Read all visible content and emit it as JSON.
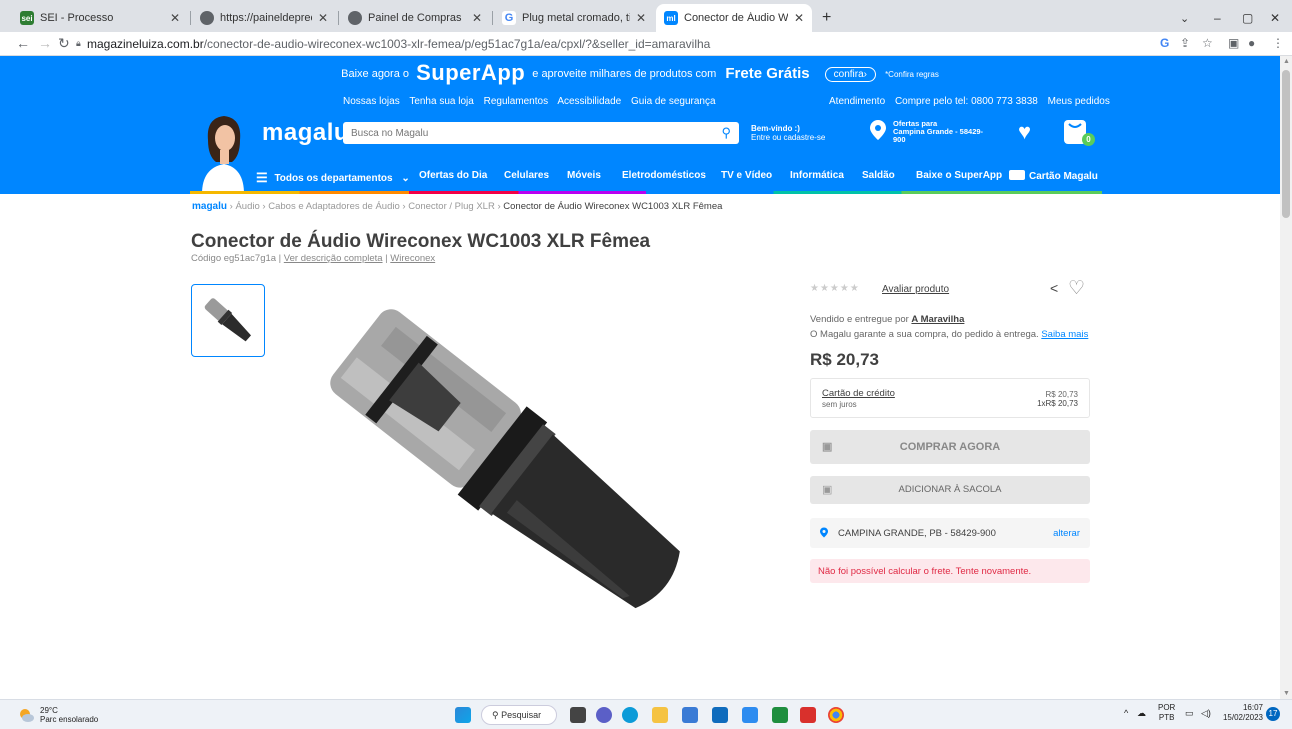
{
  "browser": {
    "tabs": [
      {
        "title": "SEI - Processo",
        "favicon_color": "#2e7d32"
      },
      {
        "title": "https://paineldeprecos.planejame",
        "favicon_color": "#5f6368"
      },
      {
        "title": "Painel de Compras",
        "favicon_color": "#5f6368"
      },
      {
        "title": "Plug metal cromado, tipo fêmea",
        "favicon_color": "#4285f4"
      },
      {
        "title": "Conector de Áudio Wireconex W",
        "favicon_color": "#0086ff"
      }
    ],
    "new_tab": "+",
    "url_host": "magazineluiza.com.br",
    "url_path": "/conector-de-audio-wireconex-wc1003-xlr-femea/p/eg51ac7g1a/ea/cpxl/?&seller_id=amaravilha"
  },
  "promo": {
    "pre": "Baixe agora o",
    "super": "SuperApp",
    "mid": "e aproveite milhares de produtos com",
    "frete": "Frete Grátis",
    "confira": "confira›",
    "regras": "*Confira regras"
  },
  "top_links_left": [
    "Nossas lojas",
    "Tenha sua loja",
    "Regulamentos",
    "Acessibilidade",
    "Guia de segurança"
  ],
  "top_links_right": [
    "Atendimento",
    "Compre pelo tel: 0800 773 3838",
    "Meus pedidos"
  ],
  "header": {
    "logo": "magalu",
    "search_placeholder": "Busca no Magalu",
    "welcome_title": "Bem-vindo :)",
    "welcome_sub": "Entre ou cadastre-se",
    "location_line1": "Ofertas para",
    "location_line2": "Campina Grande - 58429-",
    "location_line3": "900",
    "cart_count": "0"
  },
  "menu": [
    "Todos os departamentos",
    "Ofertas do Dia",
    "Celulares",
    "Móveis",
    "Eletrodomésticos",
    "TV e Vídeo",
    "Informática",
    "Saldão",
    "Baixe o SuperApp",
    "Cartão Magalu"
  ],
  "breadcrumb": {
    "home": "magalu",
    "items": [
      "Áudio",
      "Cabos e Adaptadores de Áudio",
      "Conector / Plug XLR",
      "Conector de Áudio Wireconex WC1003 XLR Fêmea"
    ]
  },
  "product": {
    "title": "Conector de Áudio Wireconex WC1003 XLR Fêmea",
    "code_label": "Código eg51ac7g1a",
    "desc_link": "Ver descrição completa",
    "brand_link": "Wireconex",
    "rate_link": "Avaliar produto",
    "sold_by_prefix": "Vendido e entregue por",
    "seller": "A Maravilha",
    "guarantee": "O Magalu garante a sua compra, do pedido à entrega.",
    "saiba": "Saiba mais",
    "price": "R$ 20,73",
    "card_label": "Cartão de crédito",
    "card_sub": "sem juros",
    "card_price": "R$ 20,73",
    "card_installment": "1xR$ 20,73",
    "buy_now": "COMPRAR AGORA",
    "add_bag": "ADICIONAR À SACOLA",
    "location": "CAMPINA GRANDE, PB - 58429-900",
    "alterar": "alterar",
    "error": "Não foi possível calcular o frete. Tente novamente."
  },
  "taskbar": {
    "temp": "29°C",
    "weather": "Parc ensolarado",
    "search": "Pesquisar",
    "lang1": "POR",
    "lang2": "PTB",
    "time": "16:07",
    "date": "15/02/2023",
    "badge": "17"
  }
}
